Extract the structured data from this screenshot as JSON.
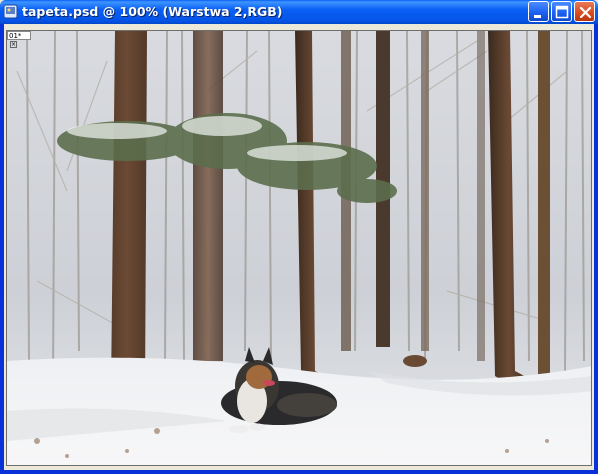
{
  "window": {
    "title": "tapeta.psd @ 100% (Warstwa 2,RGB)",
    "minimize_icon": "minimize-icon",
    "maximize_icon": "maximize-icon",
    "close_icon": "close-icon"
  },
  "canvas": {
    "corner_label": "01*",
    "corner_icon": "close-icon",
    "image_description": "snowy-forest-photo",
    "layer_icon": "dog-layer"
  },
  "colors": {
    "titlebar": "#0a5ff5",
    "close_button": "#d84a1c",
    "frame": "#0831d9"
  }
}
